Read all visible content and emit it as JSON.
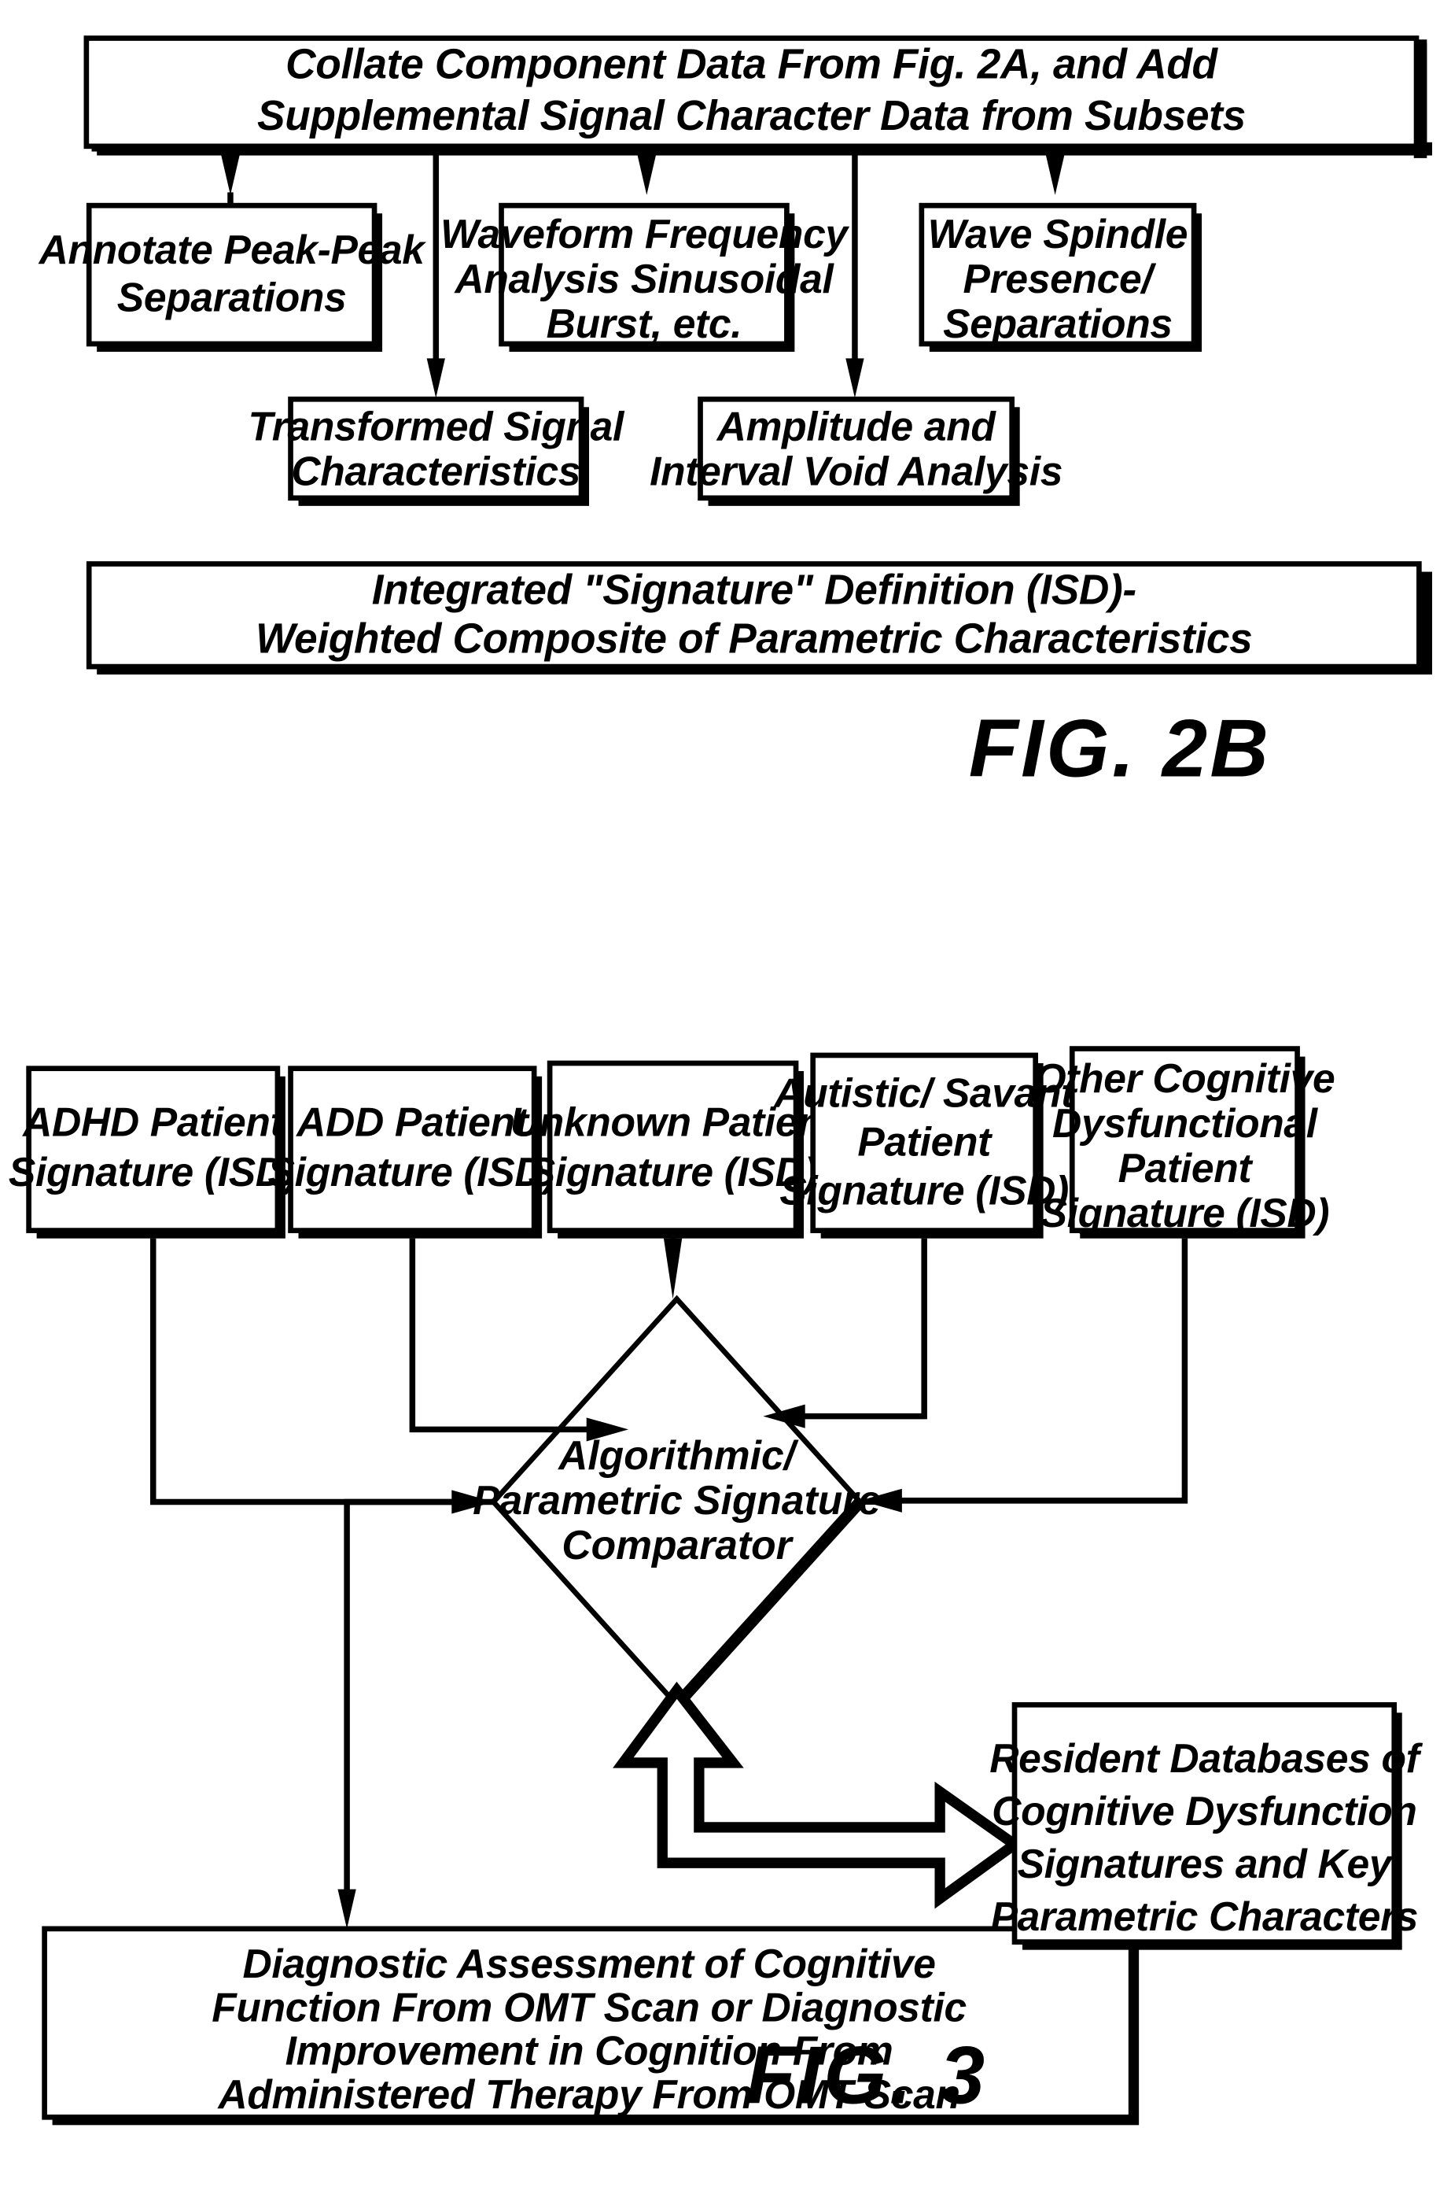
{
  "figures": [
    {
      "id": "fig-2b",
      "label": "FIG. 2B",
      "nodes": {
        "collate": {
          "lines": [
            "Collate Component Data From Fig. 2A, and Add",
            "Supplemental Signal Character Data from Subsets"
          ]
        },
        "annotate_peak": {
          "lines": [
            "Annotate Peak-Peak",
            "Separations"
          ]
        },
        "waveform_freq": {
          "lines": [
            "Waveform Frequency",
            "Analysis Sinusoidal",
            "Burst, etc."
          ]
        },
        "wave_spindle": {
          "lines": [
            "Wave Spindle",
            "Presence/",
            "Separations"
          ]
        },
        "transformed_signal": {
          "lines": [
            "Transformed Signal",
            "Characteristics"
          ]
        },
        "amplitude_interval": {
          "lines": [
            "Amplitude and",
            "Interval Void Analysis"
          ]
        },
        "isd": {
          "lines": [
            "Integrated \"Signature\" Definition (ISD)-",
            "Weighted Composite of Parametric Characteristics"
          ]
        }
      }
    },
    {
      "id": "fig-3",
      "label": "FIG. 3",
      "nodes": {
        "adhd": {
          "lines": [
            "ADHD Patient",
            "Signature (ISD)"
          ]
        },
        "add": {
          "lines": [
            "ADD Patient",
            "Signature (ISD)"
          ]
        },
        "unknown": {
          "lines": [
            "Unknown Patient",
            "Signature (ISD)"
          ]
        },
        "autistic": {
          "lines": [
            "Autistic/ Savant",
            "Patient",
            "Signature (ISD)"
          ]
        },
        "other_cognitive": {
          "lines": [
            "Other Cognitive",
            "Dysfunctional",
            "Patient",
            "Signature (ISD)"
          ]
        },
        "comparator": {
          "lines": [
            "Algorithmic/",
            "Parametric Signature",
            "Comparator"
          ]
        },
        "diagnostic": {
          "lines": [
            "Diagnostic Assessment of Cognitive",
            "Function From OMT Scan or Diagnostic",
            "Improvement in Cognition From",
            "Administered Therapy From OMT Scan"
          ]
        },
        "databases": {
          "lines": [
            "Resident Databases of",
            "Cognitive Dysfunction",
            "Signatures and Key",
            "Parametric Characters"
          ]
        }
      }
    }
  ],
  "colors": {
    "ink": "#000000",
    "paper": "#ffffff"
  }
}
